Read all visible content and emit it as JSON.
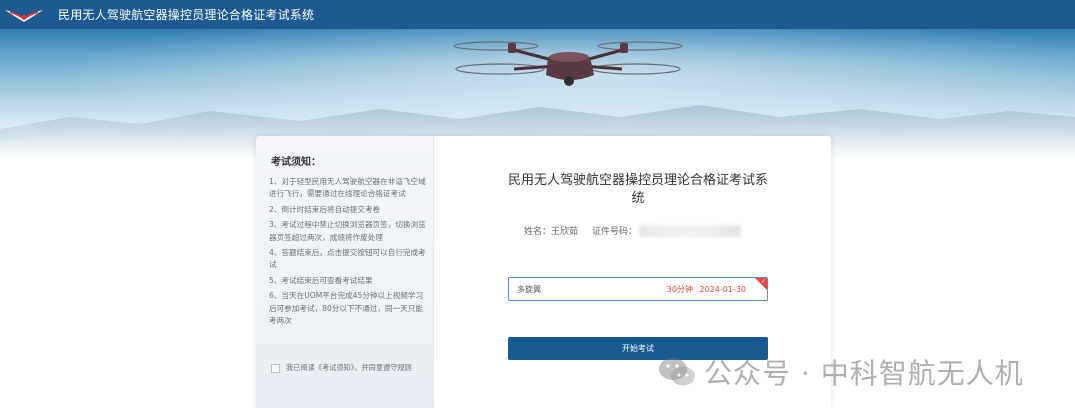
{
  "app": {
    "title": "民用无人驾驶航空器操控员理论合格证考试系统",
    "logo_icon": "wings-logo-icon"
  },
  "notice": {
    "title": "考试须知：",
    "items": [
      "1、对于轻型民用无人驾驶航空器在非适飞空域进行飞行，需要通过在线理论合格证考试",
      "2、倒计时结束后将自动提交考卷",
      "3、考试过程中禁止切换浏览器页签，切换浏览器页签超过两次，成绩将作废处理",
      "4、答题结束后，点击提交按钮可以自行完成考试",
      "5、考试结束后可查看考试结果",
      "6、当天在UOM平台完成45分钟以上视频学习后可参加考试，80分以下不通过，同一天只能考两次"
    ],
    "agree_label": "我已阅读《考试须知》，并同意遵守规则",
    "agree_checked": false
  },
  "exam": {
    "title": "民用无人驾驶航空器操控员理论合格证考试系统",
    "name_label": "姓名：",
    "name_value": "王欣茹",
    "id_label": "证件号码：",
    "option": {
      "name": "多旋翼",
      "duration": "30分钟",
      "date": "2024-01-30",
      "selected": true
    },
    "start_button": "开始考试"
  },
  "watermark": {
    "text": "公众号 · 中科智航无人机",
    "icon": "wechat-icon"
  },
  "colors": {
    "topbar": "#1d5a93",
    "button": "#1a5a93",
    "option_border": "#4f90cf",
    "accent_red": "#e0463c"
  }
}
